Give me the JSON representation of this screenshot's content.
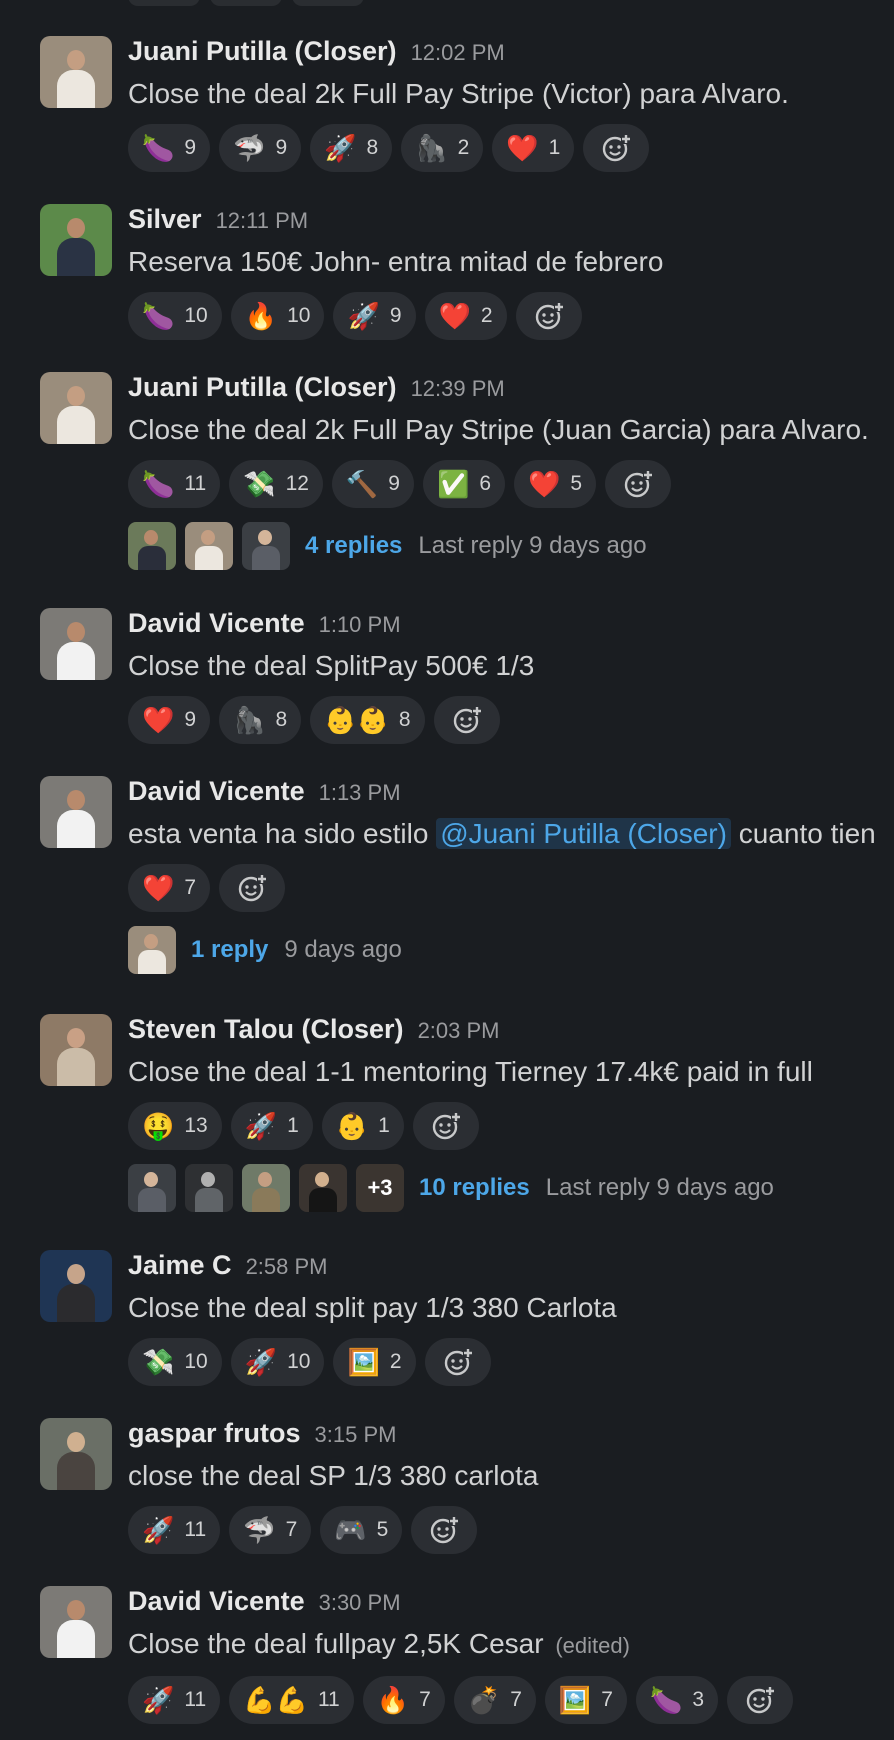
{
  "messages": [
    {
      "name": "Juani Putilla (Closer)",
      "time": "12:02 PM",
      "text": "Close the deal 2k Full Pay Stripe (Victor) para Alvaro.",
      "reactions": [
        {
          "emoji": "🍆",
          "count": "9"
        },
        {
          "emoji": "🦈",
          "count": "9"
        },
        {
          "emoji": "🚀",
          "count": "8"
        },
        {
          "emoji": "🦍",
          "count": "2"
        },
        {
          "emoji": "❤️",
          "count": "1"
        }
      ]
    },
    {
      "name": "Silver",
      "time": "12:11 PM",
      "text": "Reserva 150€ John- entra mitad de febrero",
      "reactions": [
        {
          "emoji": "🍆",
          "count": "10"
        },
        {
          "emoji": "🔥",
          "count": "10"
        },
        {
          "emoji": "🚀",
          "count": "9"
        },
        {
          "emoji": "❤️",
          "count": "2"
        }
      ]
    },
    {
      "name": "Juani Putilla (Closer)",
      "time": "12:39 PM",
      "text": "Close the deal 2k Full Pay Stripe (Juan Garcia) para Alvaro.",
      "reactions": [
        {
          "emoji": "💸",
          "count": "11"
        },
        {
          "emoji": "💸",
          "count": "12"
        },
        {
          "emoji": "🔨",
          "count": "9"
        },
        {
          "emoji": "✅",
          "count": "6"
        },
        {
          "emoji": "❤️",
          "count": "5"
        }
      ],
      "thread": {
        "replies": "4 replies",
        "last": "Last reply 9 days ago"
      }
    },
    {
      "name": "David Vicente",
      "time": "1:10 PM",
      "text": "Close the deal SplitPay 500€ 1/3",
      "reactions": [
        {
          "emoji": "❤️",
          "count": "9"
        },
        {
          "emoji": "🦍",
          "count": "8"
        },
        {
          "emoji": "👶👶",
          "count": "8"
        }
      ]
    },
    {
      "name": "David Vicente",
      "time": "1:13 PM",
      "text_before": "esta venta ha sido estilo ",
      "mention": "@Juani Putilla (Closer)",
      "text_after": " cuanto tien",
      "reactions": [
        {
          "emoji": "❤️",
          "count": "7"
        }
      ],
      "thread": {
        "replies": "1 reply",
        "last": "9 days ago"
      }
    },
    {
      "name": "Steven Talou (Closer)",
      "time": "2:03 PM",
      "text": "Close the deal 1-1 mentoring Tierney 17.4k€ paid in full",
      "reactions": [
        {
          "emoji": "🤑",
          "count": "13"
        },
        {
          "emoji": "🚀",
          "count": "1"
        },
        {
          "emoji": "👶",
          "count": "1"
        }
      ],
      "thread": {
        "replies": "10 replies",
        "last": "Last reply 9 days ago",
        "more": "+3"
      }
    },
    {
      "name": "Jaime C",
      "time": "2:58 PM",
      "text": "Close the deal split pay 1/3 380 Carlota",
      "reactions": [
        {
          "emoji": "💸",
          "count": "10"
        },
        {
          "emoji": "🚀",
          "count": "10"
        },
        {
          "emoji": "🖼️",
          "count": "2"
        }
      ]
    },
    {
      "name": "gaspar frutos",
      "time": "3:15 PM",
      "text": "close the deal SP 1/3 380 carlota",
      "reactions": [
        {
          "emoji": "🚀",
          "count": "11"
        },
        {
          "emoji": "🦈",
          "count": "7"
        },
        {
          "emoji": "🎮",
          "count": "5"
        }
      ]
    },
    {
      "name": "David Vicente",
      "time": "3:30 PM",
      "text": "Close the deal fullpay 2,5K Cesar",
      "edited": "(edited)",
      "reactions": [
        {
          "emoji": "🚀",
          "count": "11"
        },
        {
          "emoji": "💪💪",
          "count": "11"
        },
        {
          "emoji": "🔥",
          "count": "7"
        },
        {
          "emoji": "💣",
          "count": "7"
        },
        {
          "emoji": "🖼️",
          "count": "7"
        },
        {
          "emoji": "🍆",
          "count": "3"
        }
      ]
    }
  ],
  "colors": {
    "background": "#1a1d21",
    "link": "#4da7e8",
    "pill": "#2b2e33"
  }
}
